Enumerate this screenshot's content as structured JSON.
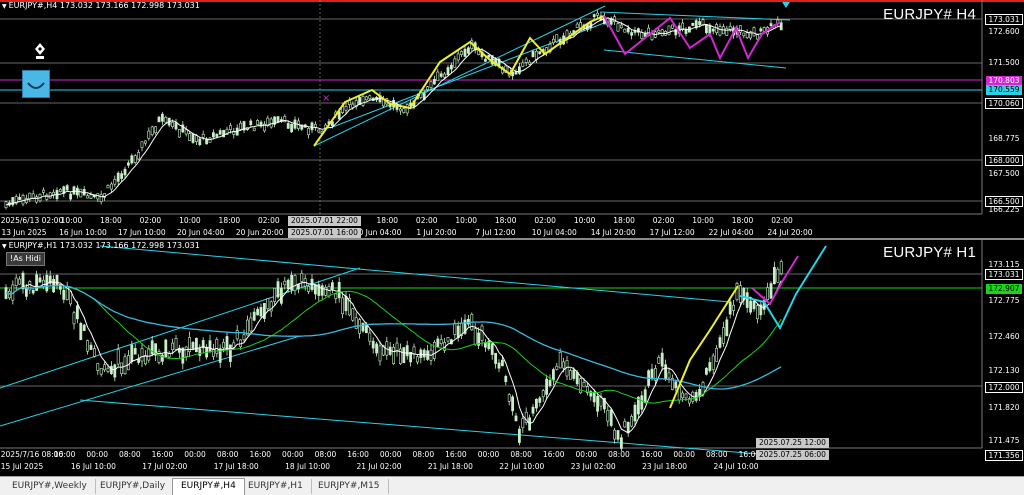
{
  "panes": {
    "h4": {
      "header": "EURJPY#,H4  173.032 173.166 172.998 173.031",
      "symbol_title": "EURJPY# H4",
      "price_labels": [
        {
          "text": "173.031",
          "style": "boxed"
        },
        {
          "text": "172.600",
          "style": "plain"
        },
        {
          "text": "171.500",
          "style": "plain"
        },
        {
          "text": "170.803",
          "style": "filled",
          "bg": "#d028d0",
          "fg": "#ffffff"
        },
        {
          "text": "170.559",
          "style": "filled",
          "bg": "#2ad0e6",
          "fg": "#000000"
        },
        {
          "text": "170.060",
          "style": "boxed"
        },
        {
          "text": "168.775",
          "style": "plain"
        },
        {
          "text": "168.000",
          "style": "boxed"
        },
        {
          "text": "167.500",
          "style": "plain"
        },
        {
          "text": "166.500",
          "style": "boxed"
        },
        {
          "text": "166.225",
          "style": "plain"
        }
      ],
      "time_labels": [
        "13 Jun 2025",
        "16 Jun 10:00",
        "17 Jun 10:00",
        "20 Jun 04:00",
        "20 Jun 20:00",
        "25 Jun 12:00",
        "30 Jun 04:00",
        "1 Jul 20:00",
        "7 Jul 12:00",
        "10 Jul 04:00",
        "14 Jul 20:00",
        "17 Jul 12:00",
        "22 Jul 04:00",
        "24 Jul 20:00"
      ],
      "sub_time_labels": [
        "2025/6/13 02:00",
        "10:00",
        "18:00",
        "02:00",
        "10:00",
        "18:00",
        "02:00",
        "02:00",
        "10:00",
        "18:00",
        "02:00",
        "10:00",
        "18:00",
        "02:00",
        "10:00",
        "18:00",
        "02:00",
        "10:00",
        "18:00",
        "02:00"
      ],
      "crosshair_tags": [
        "2025.07.01 22:00",
        "2025.07.01 16:00"
      ]
    },
    "h1": {
      "header": "EURJPY#,H1  173.032 173.166 172.998 173.031",
      "hide_button": "!As Hidi",
      "symbol_title": "EURJPY# H1",
      "price_labels": [
        {
          "text": "173.115",
          "style": "plain"
        },
        {
          "text": "173.031",
          "style": "boxed"
        },
        {
          "text": "172.907",
          "style": "filled",
          "bg": "#1ad31a",
          "fg": "#000000"
        },
        {
          "text": "172.775",
          "style": "plain"
        },
        {
          "text": "172.460",
          "style": "plain"
        },
        {
          "text": "172.130",
          "style": "plain"
        },
        {
          "text": "172.000",
          "style": "boxed"
        },
        {
          "text": "171.820",
          "style": "plain"
        },
        {
          "text": "171.475",
          "style": "plain"
        },
        {
          "text": "171.356",
          "style": "boxed"
        }
      ],
      "time_labels": [
        "15 Jul 2025",
        "16 Jul 10:00",
        "17 Jul 02:00",
        "17 Jul 18:00",
        "18 Jul 10:00",
        "21 Jul 02:00",
        "21 Jul 18:00",
        "22 Jul 10:00",
        "23 Jul 02:00",
        "23 Jul 18:00",
        "24 Jul 10:00"
      ],
      "sub_time_labels": [
        "2025/7/16 08:00",
        "16:00",
        "00:00",
        "08:00",
        "16:00",
        "00:00",
        "08:00",
        "16:00",
        "00:00",
        "08:00",
        "16:00",
        "00:00",
        "08:00",
        "16:00",
        "00:00",
        "08:00",
        "16:00",
        "00:00",
        "08:00",
        "16:00",
        "00:00",
        "08:00",
        "16:00",
        "00:00"
      ],
      "crosshair_tags": [
        "2025.07.25 12:00",
        "2025.07.25 06:00"
      ]
    }
  },
  "tabs": [
    {
      "label": "EURJPY#,Weekly",
      "active": false
    },
    {
      "label": "EURJPY#,Daily",
      "active": false
    },
    {
      "label": "EURJPY#,H4",
      "active": true
    },
    {
      "label": "EURJPY#,H1",
      "active": false
    },
    {
      "label": "EURJPY#,M15",
      "active": false
    }
  ],
  "colors": {
    "bull_candle": "#c8f0c8",
    "ma_fast": "#ffffff",
    "ma_mid": "#1bd11b",
    "ma_slow": "#3ab8e0",
    "trendline": "#2ad0e6",
    "zigzag_up": "#f0f02a",
    "zigzag_down": "#d028d0",
    "grid": "#5a5a5a"
  },
  "icons": [
    "pen-nib-icon",
    "smile-face-icon",
    "triangle-down-icon"
  ]
}
